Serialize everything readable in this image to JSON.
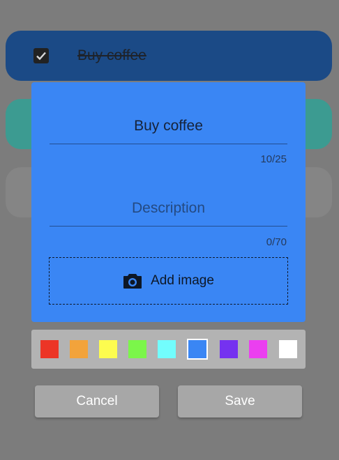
{
  "background_list": {
    "items": [
      {
        "title": "Buy coffee",
        "checked": true,
        "color": "#1b4a86"
      },
      {
        "color": "#3c9b91"
      },
      {
        "color": "#858585"
      }
    ]
  },
  "dialog": {
    "background_color": "#3a86f4",
    "title_field": {
      "value": "Buy coffee",
      "counter": "10/25"
    },
    "description_field": {
      "placeholder": "Description",
      "value": "",
      "counter": "0/70"
    },
    "add_image": {
      "label": "Add image",
      "icon": "camera-icon"
    }
  },
  "palette": {
    "swatches": [
      {
        "color": "#ec3526",
        "selected": false
      },
      {
        "color": "#f2a33b",
        "selected": false
      },
      {
        "color": "#fdfc4f",
        "selected": false
      },
      {
        "color": "#7bf64a",
        "selected": false
      },
      {
        "color": "#72fdfd",
        "selected": false
      },
      {
        "color": "#3a86f4",
        "selected": true
      },
      {
        "color": "#7532f0",
        "selected": false
      },
      {
        "color": "#eb3ff0",
        "selected": false
      },
      {
        "color": "#ffffff",
        "selected": false
      }
    ]
  },
  "actions": {
    "cancel_label": "Cancel",
    "save_label": "Save"
  }
}
